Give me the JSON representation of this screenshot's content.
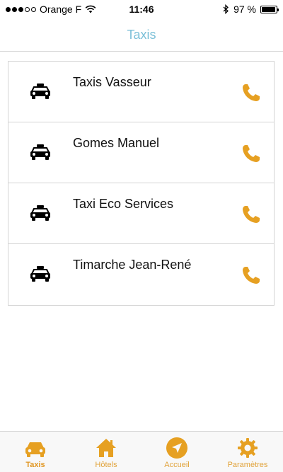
{
  "status_bar": {
    "carrier": "Orange F",
    "time": "11:46",
    "battery_text": "97 %",
    "battery_level": 0.97,
    "signal_bars_filled": 3,
    "signal_bars_total": 5
  },
  "nav": {
    "title": "Taxis"
  },
  "taxis": [
    {
      "name": "Taxis Vasseur"
    },
    {
      "name": "Gomes Manuel"
    },
    {
      "name": "Taxi Eco Services"
    },
    {
      "name": "Timarche Jean-René"
    }
  ],
  "tabs": [
    {
      "label": "Taxis",
      "icon": "car-icon",
      "active": true
    },
    {
      "label": "Hôtels",
      "icon": "home-icon",
      "active": false
    },
    {
      "label": "Accueil",
      "icon": "location-arrow-icon",
      "active": false
    },
    {
      "label": "Paramètres",
      "icon": "gear-icon",
      "active": false
    }
  ],
  "colors": {
    "accent": "#e6a022",
    "title": "#7cc0d8"
  }
}
